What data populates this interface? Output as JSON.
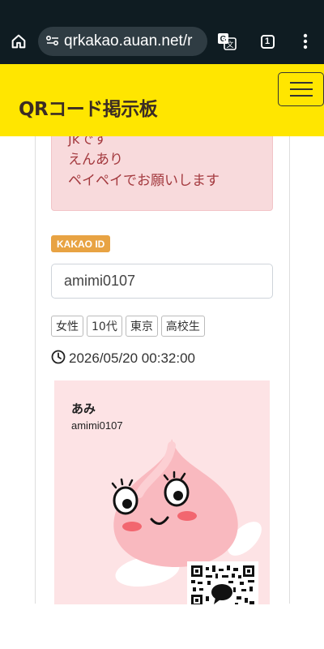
{
  "browser": {
    "url": "qrkakao.auan.net/r",
    "tab_count": "1"
  },
  "header": {
    "logo": "QRコード掲示板"
  },
  "post": {
    "message_lines": [
      "jkです",
      "えんあり",
      "ペイペイでお願いします"
    ],
    "kakao_label": "KAKAO ID",
    "kakao_id": "amimi0107",
    "tags": [
      "女性",
      "10代",
      "東京",
      "高校生"
    ],
    "datetime": "2026/05/20 00:32:00"
  },
  "profile_card": {
    "name": "あみ",
    "id": "amimi0107",
    "background": "#fde3e5"
  },
  "colors": {
    "browser_bar": "#0f1c22",
    "header": "#ffe600",
    "badge": "#e8a343",
    "message_text": "#a43a3f",
    "message_bg": "#f8dadc"
  }
}
